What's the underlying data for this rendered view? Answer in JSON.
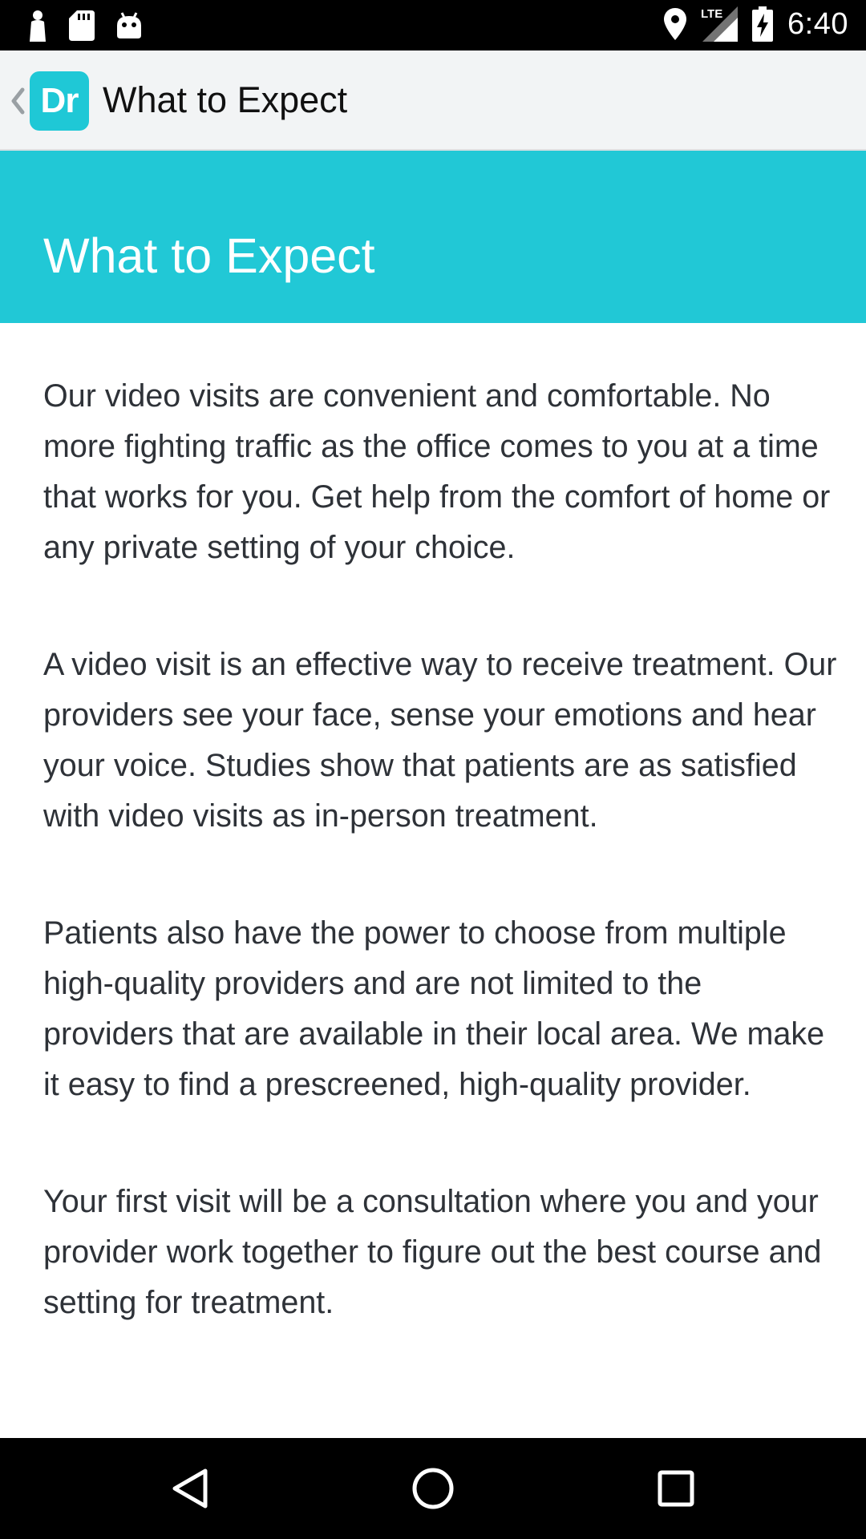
{
  "status_bar": {
    "left_icons": [
      "person-icon",
      "sd-card-icon",
      "android-icon"
    ],
    "right_icons": [
      "location-icon",
      "lte-signal-icon",
      "battery-charging-icon"
    ],
    "network_label": "LTE",
    "time": "6:40"
  },
  "toolbar": {
    "back_icon": "chevron-left-icon",
    "logo_text": "Dr",
    "title": "What to Expect"
  },
  "banner": {
    "title": "What to Expect"
  },
  "content": {
    "paragraphs": [
      "Our video visits are convenient and comfortable. No more fighting traffic as the office comes to you at a time that works for you. Get help from the comfort of home or any private setting of your choice.",
      "A video visit is an effective way to receive treatment. Our providers see your face, sense your emotions and hear your voice. Studies show that patients are as satisfied with video visits as in-person treatment.",
      "Patients also have the power to choose from multiple high-quality providers and are not limited to the providers that are available in their local area. We make it easy to find a prescreened, high-quality provider.",
      "Your first visit will be a consultation where you and your provider work together to figure out the best course and setting for treatment."
    ]
  },
  "nav_bar": {
    "buttons": [
      "back-triangle-icon",
      "home-circle-icon",
      "recents-square-icon"
    ]
  },
  "colors": {
    "accent": "#21c8d6",
    "toolbar_bg": "#f2f4f5",
    "body_text": "#2e3238",
    "system_bars": "#000000"
  }
}
